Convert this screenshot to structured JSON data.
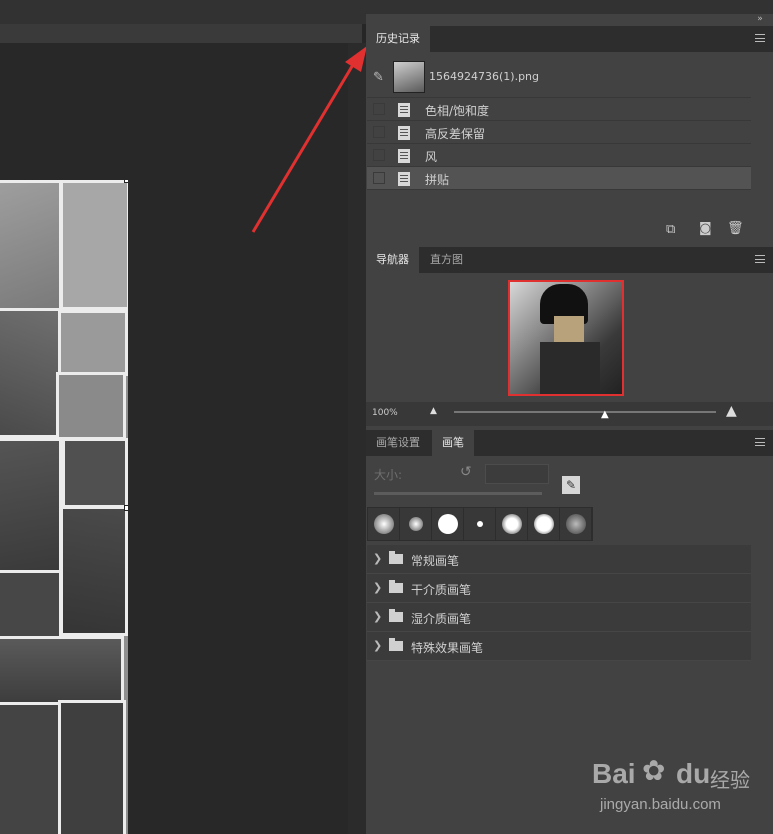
{
  "history_panel": {
    "tab_label": "历史记录",
    "snapshot_name": "1564924736(1).png",
    "steps": [
      {
        "label": "色相/饱和度",
        "selected": false
      },
      {
        "label": "高反差保留",
        "selected": false
      },
      {
        "label": "风",
        "selected": false
      },
      {
        "label": "拼贴",
        "selected": true
      }
    ]
  },
  "navigator_panel": {
    "tabs": [
      "导航器",
      "直方图"
    ],
    "zoom": "100%",
    "zoom_fraction": 0.58
  },
  "brush_panel": {
    "tabs": [
      "画笔设置",
      "画笔"
    ],
    "size_label": "大小:",
    "size_value": "",
    "folders": [
      "常规画笔",
      "干介质画笔",
      "湿介质画笔",
      "特殊效果画笔"
    ]
  },
  "watermark": {
    "brand": "Bai",
    "brand_suffix": "du",
    "product": "经验",
    "url": "jingyan.baidu.com"
  },
  "colors": {
    "accent_arrow": "#e03030",
    "selected_row": "#535353"
  }
}
